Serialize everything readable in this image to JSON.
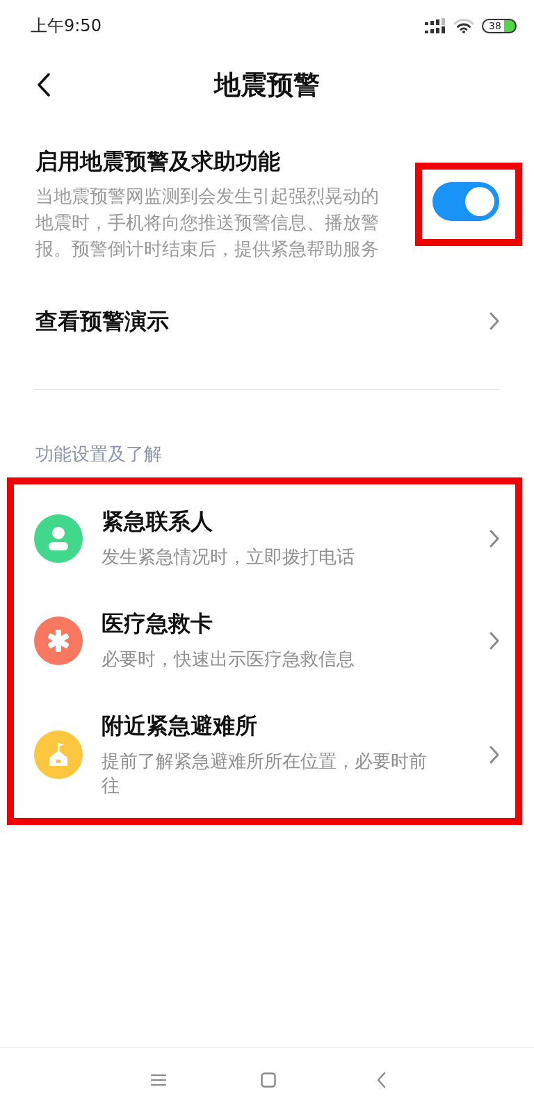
{
  "status_bar": {
    "time": "上午9:50",
    "battery": "38"
  },
  "header": {
    "title": "地震预警"
  },
  "main_setting": {
    "title": "启用地震预警及求助功能",
    "description": "当地震预警网监测到会发生引起强烈晃动的地震时，手机将向您推送预警信息、播放警报。预警倒计时结束后，提供紧急帮助服务",
    "on": true,
    "highlighted": true
  },
  "demo_row": {
    "label": "查看预警演示"
  },
  "features": {
    "header": "功能设置及了解",
    "highlighted": true,
    "items": [
      {
        "kind": "contact",
        "title": "紧急联系人",
        "subtitle": "发生紧急情况时，立即拨打电话",
        "color": "#42d88b"
      },
      {
        "kind": "medical",
        "title": "医疗急救卡",
        "subtitle": "必要时，快速出示医疗急救信息",
        "color": "#f7775f"
      },
      {
        "kind": "shelter",
        "title": "附近紧急避难所",
        "subtitle": "提前了解紧急避难所所在位置，必要时前往",
        "color": "#fdc63f"
      }
    ]
  }
}
